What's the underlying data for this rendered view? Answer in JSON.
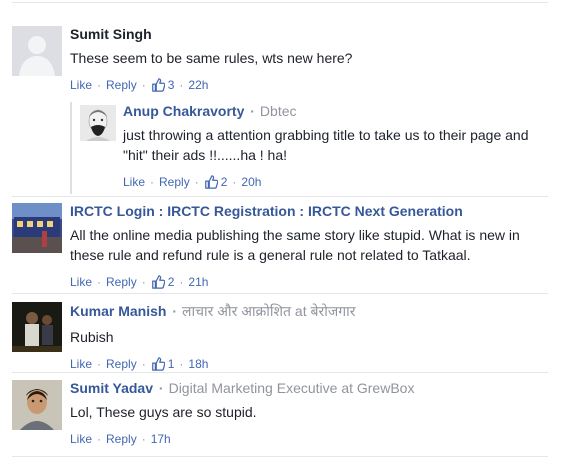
{
  "comments": [
    {
      "name": "Sumit Singh",
      "subtitle": "",
      "text": "These seem to be same rules, wts new here?",
      "like": "Like",
      "reply": "Reply",
      "likes": "3",
      "time": "22h"
    },
    {
      "name": "Anup Chakravorty",
      "subtitle": "Dbtec",
      "text": "just throwing a attention grabbing title to take us to their page and \"hit\" their ads !!......ha ! ha!",
      "like": "Like",
      "reply": "Reply",
      "likes": "2",
      "time": "20h"
    },
    {
      "name": "IRCTC Login : IRCTC Registration : IRCTC Next Generation",
      "subtitle": "",
      "text": "All the online media publishing the same story like stupid. What is new in these rule and refund rule is a general rule not related to Tatkaal.",
      "like": "Like",
      "reply": "Reply",
      "likes": "2",
      "time": "21h"
    },
    {
      "name": "Kumar Manish",
      "subtitle": "लाचार और आक्रोशित at बेरोजगार",
      "text": "Rubish",
      "like": "Like",
      "reply": "Reply",
      "likes": "1",
      "time": "18h"
    },
    {
      "name": "Sumit Yadav",
      "subtitle": "Digital Marketing Executive at GrewBox",
      "text": "Lol, These guys are so stupid.",
      "like": "Like",
      "reply": "Reply",
      "likes": "",
      "time": "17h"
    }
  ],
  "separator": "·",
  "icons": {
    "like": "thumbs-up-icon"
  },
  "colors": {
    "link": "#4267b2",
    "name": "#365899",
    "meta": "#90949c"
  }
}
